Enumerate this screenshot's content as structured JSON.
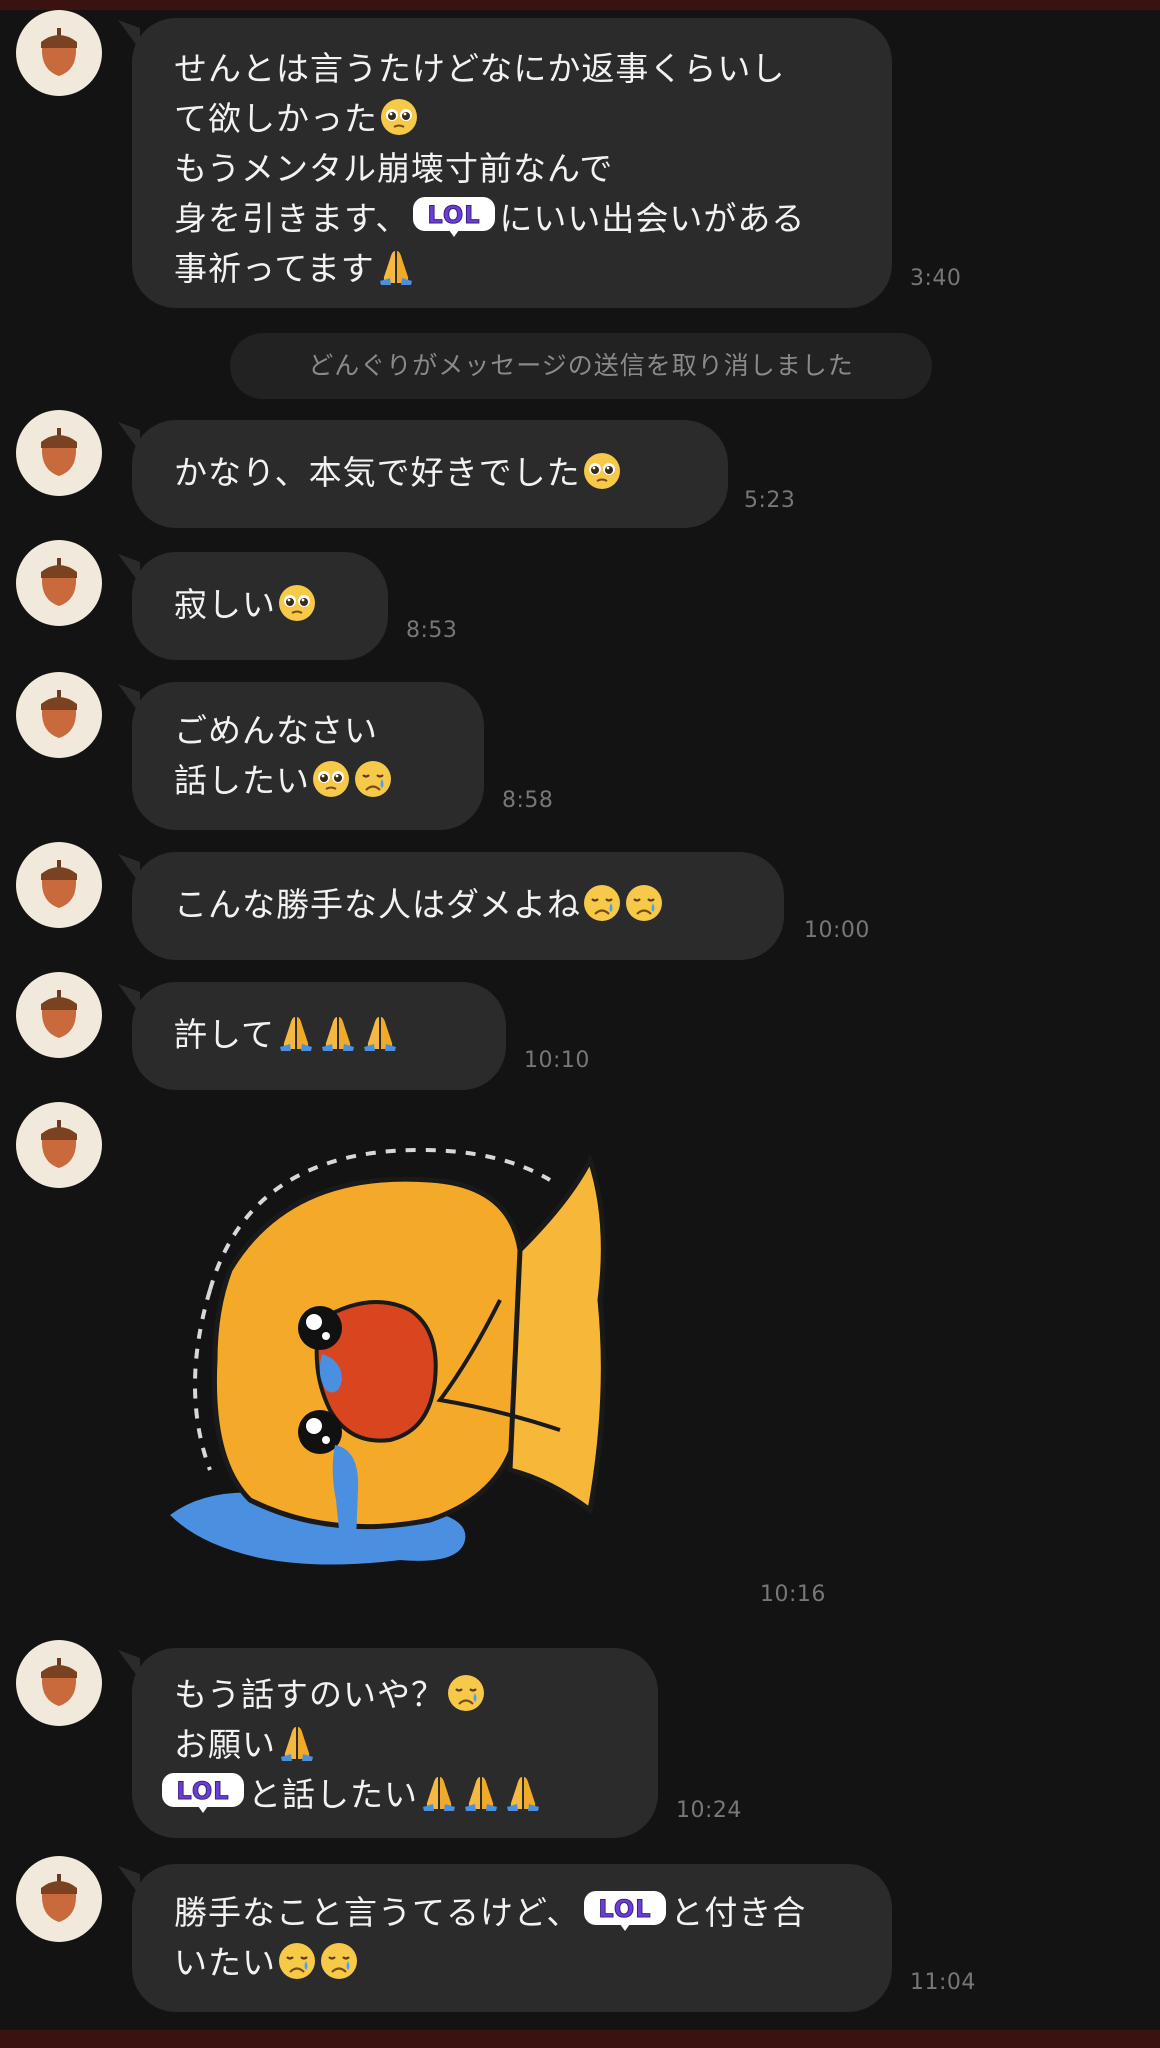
{
  "system_message": "どんぐりがメッセージの送信を取り消しました",
  "messages": [
    {
      "lines": [
        "せんとは言うたけどなにか返事くらいし",
        "て欲しかった",
        "もうメンタル崩壊寸前なんで",
        "身を引きます、",
        "にいい出会いがある",
        "事祈ってます"
      ],
      "time": "3:40"
    },
    {
      "text": "かなり、本気で好きでした",
      "time": "5:23"
    },
    {
      "text": "寂しい",
      "time": "8:53"
    },
    {
      "lines": [
        "ごめんなさい",
        "話したい"
      ],
      "time": "8:58"
    },
    {
      "text": "こんな勝手な人はダメよね",
      "time": "10:00"
    },
    {
      "text": "許して",
      "time": "10:10"
    },
    {
      "sticker": "crying-duck-sticker",
      "time": "10:16"
    },
    {
      "lines": [
        "もう話すのいや？",
        "お願い",
        "と話したい"
      ],
      "time": "10:24"
    },
    {
      "lines": [
        "勝手なこと言うてるけど、",
        "と付き合",
        "いたい"
      ],
      "time": "11:04"
    }
  ],
  "lol_sticker_text": "LOL",
  "icons": {
    "avatar": "acorn-icon",
    "pleading": "pleading-face-emoji",
    "crying": "crying-face-emoji",
    "pray": "folded-hands-emoji",
    "lol": "lol-sticker-emoji"
  },
  "colors": {
    "background": "#131313",
    "bubble": "#2b2b2b",
    "text": "#f2f2f2",
    "timestamp": "#777777",
    "avatar_bg": "#f1e9dc",
    "acorn": "#c96a3d",
    "lol_purple": "#6a3fd1",
    "top_bar": "#3a1210"
  }
}
